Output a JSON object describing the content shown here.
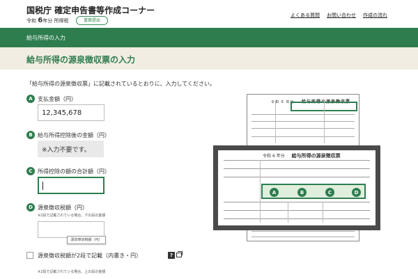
{
  "header": {
    "title": "国税庁 確定申告書等作成コーナー",
    "era": "令和",
    "year": "6",
    "year_suffix": "年分",
    "tax_type": "所得税",
    "print_button": "書面提出",
    "links": [
      "よくある質問",
      "お問い合わせ",
      "作成の流れ"
    ]
  },
  "breadcrumb": "給与所得の入力",
  "page_title": "給与所得の源泉徴収票の入力",
  "instruction": "「給与所得の源泉徴収票」に記載されているとおりに、入力してください。",
  "fields": {
    "a": {
      "badge": "A",
      "label": "支払金額（円）",
      "value": "12,345,678"
    },
    "b": {
      "badge": "B",
      "label": "給与所得控除後の金額（円）",
      "value": "※入力不要です。"
    },
    "c": {
      "badge": "C",
      "label": "所得控除の額の合計額（円）",
      "value": ""
    },
    "d": {
      "badge": "D",
      "label": "源泉徴収税額（円）",
      "note": "※2段で記載されている場合、下の段の金額",
      "tooltip": "源泉徴収税額（円）"
    }
  },
  "checkbox": {
    "label": "源泉徴収税額が2段で記載（内書き・円）",
    "checked": false,
    "help": "?",
    "note": "※2段で記載されている場合、上の段の金額"
  },
  "illustration": {
    "era": "令和",
    "year": "6",
    "year_suffix": "年分",
    "doc_title": "給与所得の源泉徴収票",
    "marks": [
      "A",
      "B",
      "C",
      "D"
    ]
  },
  "colors": {
    "accent": "#2e7d4f",
    "title_band": "#f1ede3"
  }
}
